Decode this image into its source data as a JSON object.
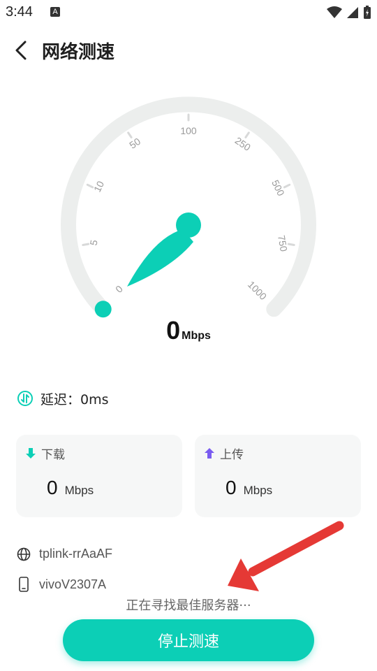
{
  "status_bar": {
    "time": "3:44",
    "indicator": "A"
  },
  "header": {
    "title": "网络测速"
  },
  "gauge": {
    "ticks": [
      "0",
      "5",
      "10",
      "50",
      "100",
      "250",
      "500",
      "750",
      "1000"
    ],
    "speed_value": "0",
    "speed_unit": "Mbps",
    "needle_level": 0
  },
  "latency": {
    "label": "延迟：0ms"
  },
  "download": {
    "label": "下载",
    "value": "0",
    "unit": "Mbps"
  },
  "upload": {
    "label": "上传",
    "value": "0",
    "unit": "Mbps"
  },
  "network": {
    "wifi_name": "tplink-rrAaAF",
    "device_name": "vivoV2307A"
  },
  "searching_text": "正在寻找最佳服务器···",
  "stop_button": {
    "label": "停止测速"
  },
  "colors": {
    "accent": "#0ccfb6",
    "track": "#eceeed",
    "download_icon": "#0ccfb6",
    "upload_icon": "#7a5cf0",
    "annotation": "#e53935"
  }
}
